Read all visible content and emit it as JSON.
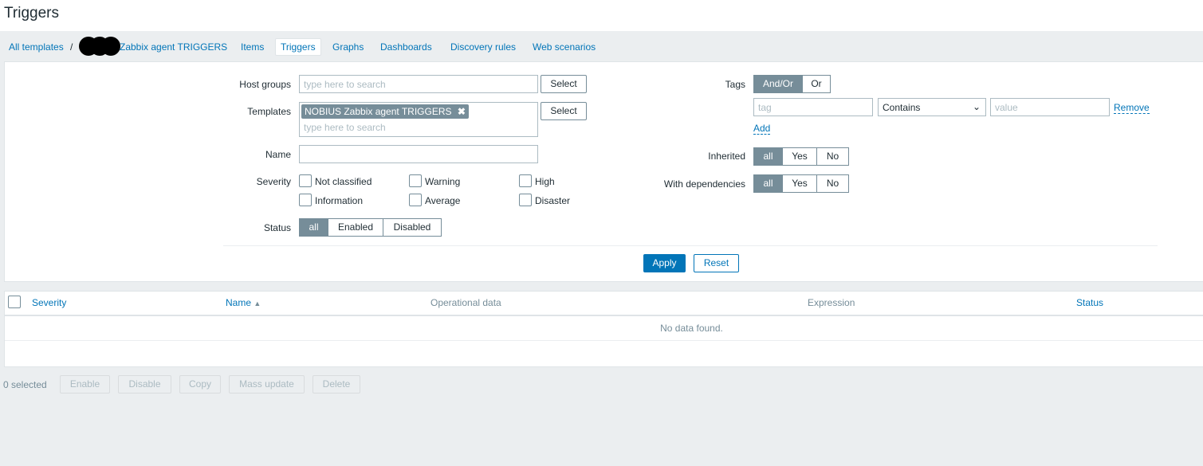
{
  "page": {
    "title": "Triggers"
  },
  "nav": {
    "all_templates": "All templates",
    "separator": "/",
    "template": "Zabbix agent TRIGGERS",
    "tabs": [
      "Items",
      "Triggers",
      "Graphs",
      "Dashboards",
      "Discovery rules",
      "Web scenarios"
    ],
    "active_tab": "Triggers"
  },
  "filter": {
    "host_groups_label": "Host groups",
    "templates_label": "Templates",
    "name_label": "Name",
    "severity_label": "Severity",
    "status_label": "Status",
    "placeholder": "type here to search",
    "select": "Select",
    "template_chip": "NOBIUS Zabbix agent TRIGGERS",
    "severities": [
      "Not classified",
      "Warning",
      "High",
      "Information",
      "Average",
      "Disaster"
    ],
    "status_options": [
      "all",
      "Enabled",
      "Disabled"
    ],
    "tags_label": "Tags",
    "tags_ops": [
      "And/Or",
      "Or"
    ],
    "tag_placeholder": "tag",
    "operator": "Contains",
    "value_placeholder": "value",
    "remove": "Remove",
    "add": "Add",
    "inherited_label": "Inherited",
    "deps_label": "With dependencies",
    "tri_options": [
      "all",
      "Yes",
      "No"
    ],
    "apply": "Apply",
    "reset": "Reset"
  },
  "table": {
    "columns": [
      "Severity",
      "Name",
      "Operational data",
      "Expression",
      "Status"
    ],
    "sort_indicator": "▲",
    "empty": "No data found."
  },
  "footer": {
    "selected": "0 selected",
    "actions": [
      "Enable",
      "Disable",
      "Copy",
      "Mass update",
      "Delete"
    ]
  },
  "colors": {
    "accent": "#0275b8",
    "segment_active": "#768d99",
    "apply": "#0275b8"
  }
}
